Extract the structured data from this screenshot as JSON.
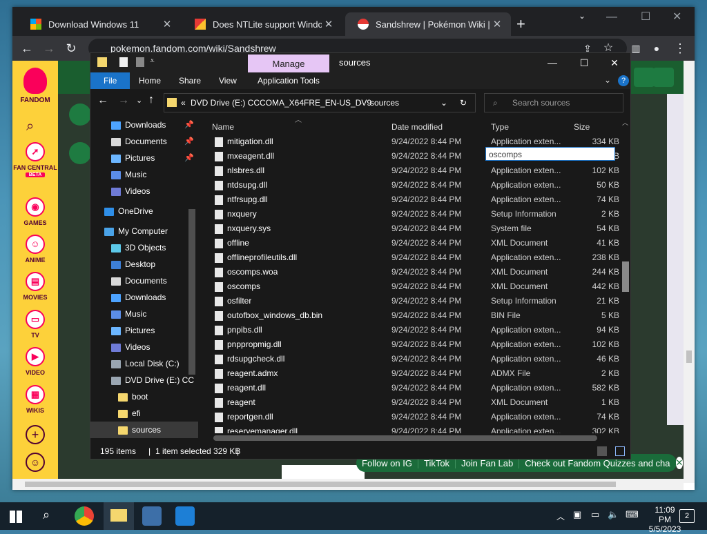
{
  "browser": {
    "tabs": [
      {
        "title": "Download Windows 11",
        "close": "✕"
      },
      {
        "title": "Does NTLite support Windows IS",
        "close": "✕"
      },
      {
        "title": "Sandshrew | Pokémon Wiki | Fan",
        "close": "✕"
      }
    ],
    "new_tab": "+",
    "url": "pokemon.fandom.com/wiki/Sandshrew"
  },
  "fandom": {
    "logo": "FANDOM",
    "rail": [
      "FAN CENTRAL",
      "GAMES",
      "ANIME",
      "MOVIES",
      "TV",
      "VIDEO",
      "WIKIS"
    ],
    "beta": "BETA",
    "follow": [
      "Follow on IG",
      "TikTok",
      "Join Fan Lab",
      "Check out Fandom Quizzes and cha"
    ]
  },
  "explorer": {
    "manage_label": "Manage",
    "title": "sources",
    "ribbon_tabs": [
      "File",
      "Home",
      "Share",
      "View",
      "Application Tools"
    ],
    "address": {
      "prefix": "«",
      "drive": "DVD Drive (E:) CCCOMA_X64FRE_EN-US_DV9",
      "sep": "›",
      "folder": "sources"
    },
    "search_placeholder": "Search sources",
    "nav": [
      {
        "label": "Downloads",
        "pinned": true,
        "icon_color": "#4da3ff"
      },
      {
        "label": "Documents",
        "pinned": true,
        "icon_color": "#d9d9d9"
      },
      {
        "label": "Pictures",
        "pinned": true,
        "icon_color": "#6cb6ff"
      },
      {
        "label": "Music",
        "pinned": false,
        "icon_color": "#5b8de8"
      },
      {
        "label": "Videos",
        "pinned": false,
        "icon_color": "#6f7bd6"
      },
      {
        "label": "OneDrive",
        "pinned": false,
        "icon_color": "#2f8fe8"
      },
      {
        "label": "My Computer",
        "pinned": false,
        "icon_color": "#4aa3e8"
      },
      {
        "label": "3D Objects",
        "pinned": false,
        "icon_color": "#5cc8e8"
      },
      {
        "label": "Desktop",
        "pinned": false,
        "icon_color": "#3d7fd6"
      },
      {
        "label": "Documents",
        "pinned": false,
        "icon_color": "#d9d9d9"
      },
      {
        "label": "Downloads",
        "pinned": false,
        "icon_color": "#4da3ff"
      },
      {
        "label": "Music",
        "pinned": false,
        "icon_color": "#5b8de8"
      },
      {
        "label": "Pictures",
        "pinned": false,
        "icon_color": "#6cb6ff"
      },
      {
        "label": "Videos",
        "pinned": false,
        "icon_color": "#6f7bd6"
      },
      {
        "label": "Local Disk (C:)",
        "pinned": false,
        "icon_color": "#9aa6b2"
      },
      {
        "label": "DVD Drive (E:) CC",
        "pinned": false,
        "icon_color": "#9aa6b2"
      },
      {
        "label": "boot",
        "pinned": false,
        "icon_color": "#f5d76e"
      },
      {
        "label": "efi",
        "pinned": false,
        "icon_color": "#f5d76e"
      },
      {
        "label": "sources",
        "pinned": false,
        "icon_color": "#f5d76e"
      }
    ],
    "columns": [
      "Name",
      "Date modified",
      "Type",
      "Size"
    ],
    "rename_value": "oscomps",
    "files": [
      {
        "name": "mitigation.dll",
        "date": "9/24/2022 8:44 PM",
        "type": "Application exten...",
        "size": "334 KB"
      },
      {
        "name": "mxeagent.dll",
        "date": "9/24/2022 8:44 PM",
        "type": "",
        "size": "B"
      },
      {
        "name": "nlsbres.dll",
        "date": "9/24/2022 8:44 PM",
        "type": "Application exten...",
        "size": "102 KB"
      },
      {
        "name": "ntdsupg.dll",
        "date": "9/24/2022 8:44 PM",
        "type": "Application exten...",
        "size": "50 KB"
      },
      {
        "name": "ntfrsupg.dll",
        "date": "9/24/2022 8:44 PM",
        "type": "Application exten...",
        "size": "74 KB"
      },
      {
        "name": "nxquery",
        "date": "9/24/2022 8:44 PM",
        "type": "Setup Information",
        "size": "2 KB"
      },
      {
        "name": "nxquery.sys",
        "date": "9/24/2022 8:44 PM",
        "type": "System file",
        "size": "54 KB"
      },
      {
        "name": "offline",
        "date": "9/24/2022 8:44 PM",
        "type": "XML Document",
        "size": "41 KB"
      },
      {
        "name": "offlineprofileutils.dll",
        "date": "9/24/2022 8:44 PM",
        "type": "Application exten...",
        "size": "238 KB"
      },
      {
        "name": "oscomps.woa",
        "date": "9/24/2022 8:44 PM",
        "type": "XML Document",
        "size": "244 KB"
      },
      {
        "name": "oscomps",
        "date": "9/24/2022 8:44 PM",
        "type": "XML Document",
        "size": "442 KB"
      },
      {
        "name": "osfilter",
        "date": "9/24/2022 8:44 PM",
        "type": "Setup Information",
        "size": "21 KB"
      },
      {
        "name": "outofbox_windows_db.bin",
        "date": "9/24/2022 8:44 PM",
        "type": "BIN File",
        "size": "5 KB"
      },
      {
        "name": "pnpibs.dll",
        "date": "9/24/2022 8:44 PM",
        "type": "Application exten...",
        "size": "94 KB"
      },
      {
        "name": "pnppropmig.dll",
        "date": "9/24/2022 8:44 PM",
        "type": "Application exten...",
        "size": "102 KB"
      },
      {
        "name": "rdsupgcheck.dll",
        "date": "9/24/2022 8:44 PM",
        "type": "Application exten...",
        "size": "46 KB"
      },
      {
        "name": "reagent.admx",
        "date": "9/24/2022 8:44 PM",
        "type": "ADMX File",
        "size": "2 KB"
      },
      {
        "name": "reagent.dll",
        "date": "9/24/2022 8:44 PM",
        "type": "Application exten...",
        "size": "582 KB"
      },
      {
        "name": "reagent",
        "date": "9/24/2022 8:44 PM",
        "type": "XML Document",
        "size": "1 KB"
      },
      {
        "name": "reportgen.dll",
        "date": "9/24/2022 8:44 PM",
        "type": "Application exten...",
        "size": "74 KB"
      },
      {
        "name": "reservemanager.dll",
        "date": "9/24/2022 8:44 PM",
        "type": "Application exten...",
        "size": "302 KB"
      }
    ],
    "status": {
      "count": "195 items",
      "selected": "1 item selected  329 KB"
    }
  },
  "taskbar": {
    "time": "11:09 PM",
    "date": "5/5/2023",
    "notifications": "2"
  },
  "colors": {
    "fandom_yellow": "#fdd13a",
    "fandom_pink": "#fa005a",
    "accent_blue": "#1a73c9",
    "manage_purple": "#e6c6f5"
  }
}
